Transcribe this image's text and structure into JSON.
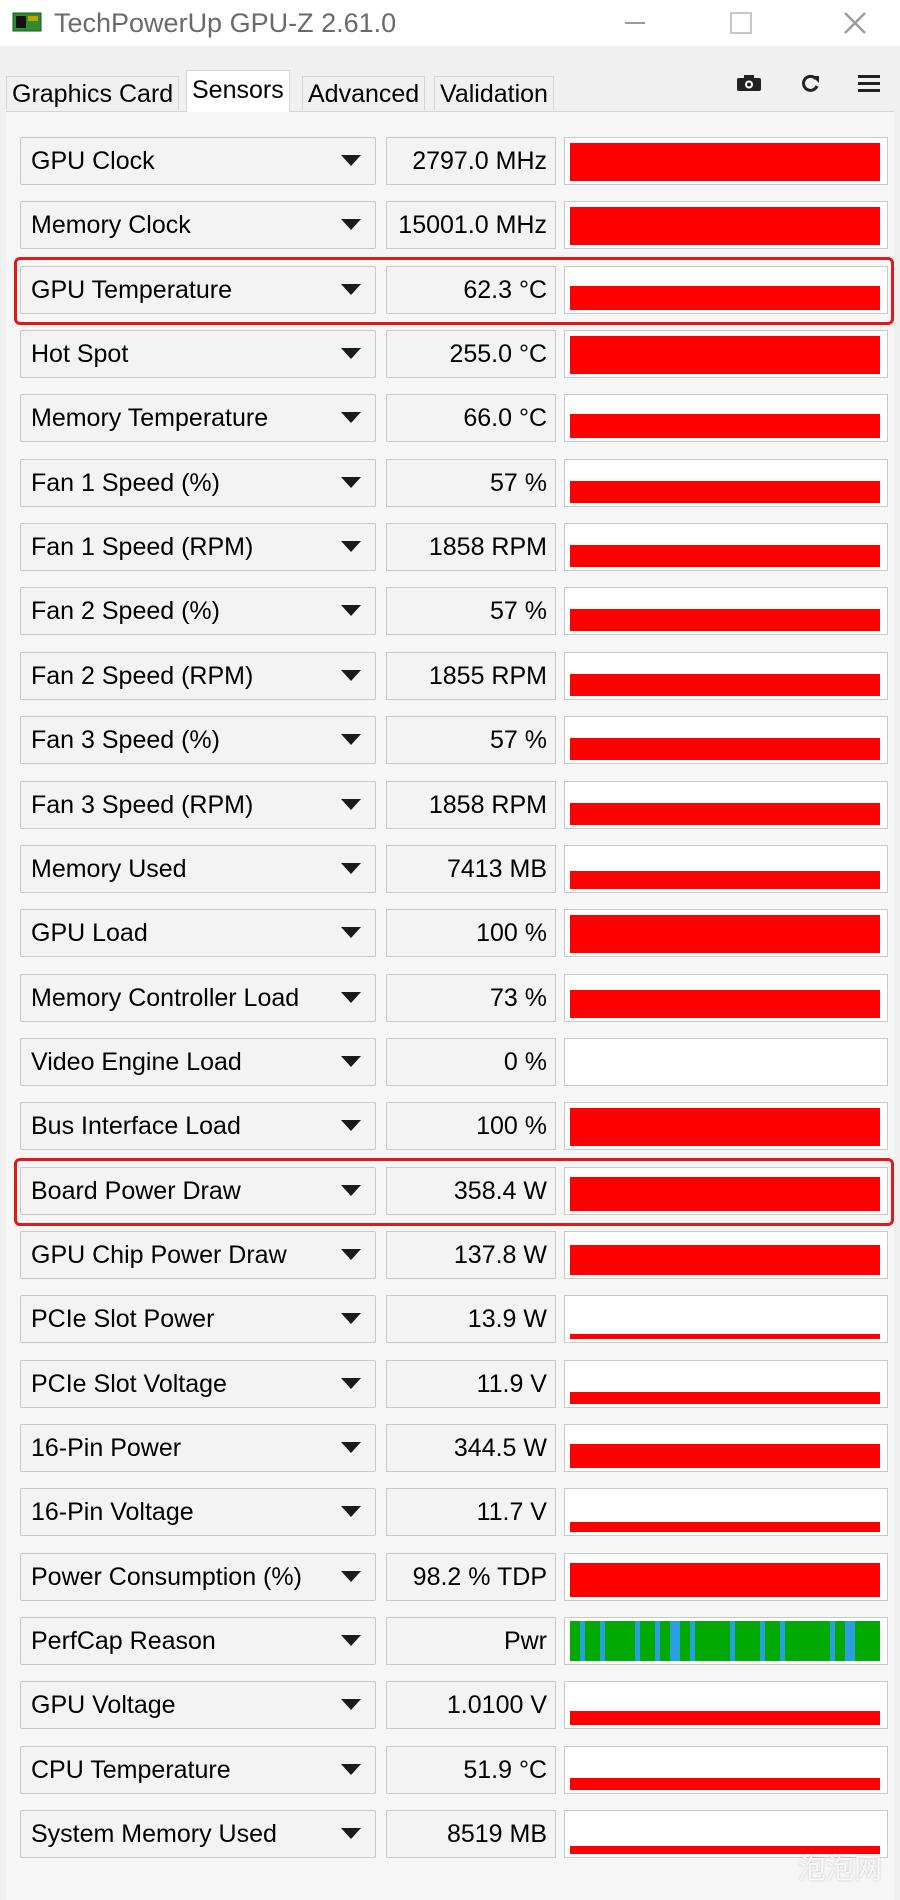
{
  "window": {
    "title": "TechPowerUp GPU-Z 2.61.0"
  },
  "tabs": [
    {
      "label": "Graphics Card",
      "active": false
    },
    {
      "label": "Sensors",
      "active": true
    },
    {
      "label": "Advanced",
      "active": false
    },
    {
      "label": "Validation",
      "active": false
    }
  ],
  "toolbar": {
    "icons": [
      "camera-icon",
      "refresh-icon",
      "menu-icon"
    ]
  },
  "colors": {
    "graph_fill": "#ff0000",
    "highlight": "#e01a1a",
    "perfcap_green": "#00aa00",
    "perfcap_blue": "#2a9fe0"
  },
  "sensors": [
    {
      "name": "GPU Clock",
      "value": "2797.0 MHz",
      "level": 0.95
    },
    {
      "name": "Memory Clock",
      "value": "15001.0 MHz",
      "level": 0.95
    },
    {
      "name": "GPU Temperature",
      "value": "62.3 °C",
      "level": 0.6,
      "highlighted": true
    },
    {
      "name": "Hot Spot",
      "value": "255.0 °C",
      "level": 0.95
    },
    {
      "name": "Memory Temperature",
      "value": "66.0 °C",
      "level": 0.6
    },
    {
      "name": "Fan 1 Speed (%)",
      "value": "57 %",
      "level": 0.55
    },
    {
      "name": "Fan 1 Speed (RPM)",
      "value": "1858 RPM",
      "level": 0.55
    },
    {
      "name": "Fan 2 Speed (%)",
      "value": "57 %",
      "level": 0.55
    },
    {
      "name": "Fan 2 Speed (RPM)",
      "value": "1855 RPM",
      "level": 0.55
    },
    {
      "name": "Fan 3 Speed (%)",
      "value": "57 %",
      "level": 0.55
    },
    {
      "name": "Fan 3 Speed (RPM)",
      "value": "1858 RPM",
      "level": 0.55
    },
    {
      "name": "Memory Used",
      "value": "7413 MB",
      "level": 0.45
    },
    {
      "name": "GPU Load",
      "value": "100 %",
      "level": 0.95
    },
    {
      "name": "Memory Controller Load",
      "value": "73 %",
      "level": 0.7
    },
    {
      "name": "Video Engine Load",
      "value": "0 %",
      "level": 0.0
    },
    {
      "name": "Bus Interface Load",
      "value": "100 %",
      "level": 0.95
    },
    {
      "name": "Board Power Draw",
      "value": "358.4 W",
      "level": 0.85,
      "highlighted": true
    },
    {
      "name": "GPU Chip Power Draw",
      "value": "137.8 W",
      "level": 0.75
    },
    {
      "name": "PCIe Slot Power",
      "value": "13.9 W",
      "level": 0.12
    },
    {
      "name": "PCIe Slot Voltage",
      "value": "11.9 V",
      "level": 0.3
    },
    {
      "name": "16-Pin Power",
      "value": "344.5 W",
      "level": 0.6
    },
    {
      "name": "16-Pin Voltage",
      "value": "11.7 V",
      "level": 0.25
    },
    {
      "name": "Power Consumption (%)",
      "value": "98.2 % TDP",
      "level": 0.85
    },
    {
      "name": "PerfCap Reason",
      "value": "Pwr",
      "level": 1.0,
      "perfcap": true
    },
    {
      "name": "GPU Voltage",
      "value": "1.0100 V",
      "level": 0.35
    },
    {
      "name": "CPU Temperature",
      "value": "51.9 °C",
      "level": 0.3
    },
    {
      "name": "System Memory Used",
      "value": "8519 MB",
      "level": 0.2
    }
  ],
  "watermark": "泡泡网"
}
